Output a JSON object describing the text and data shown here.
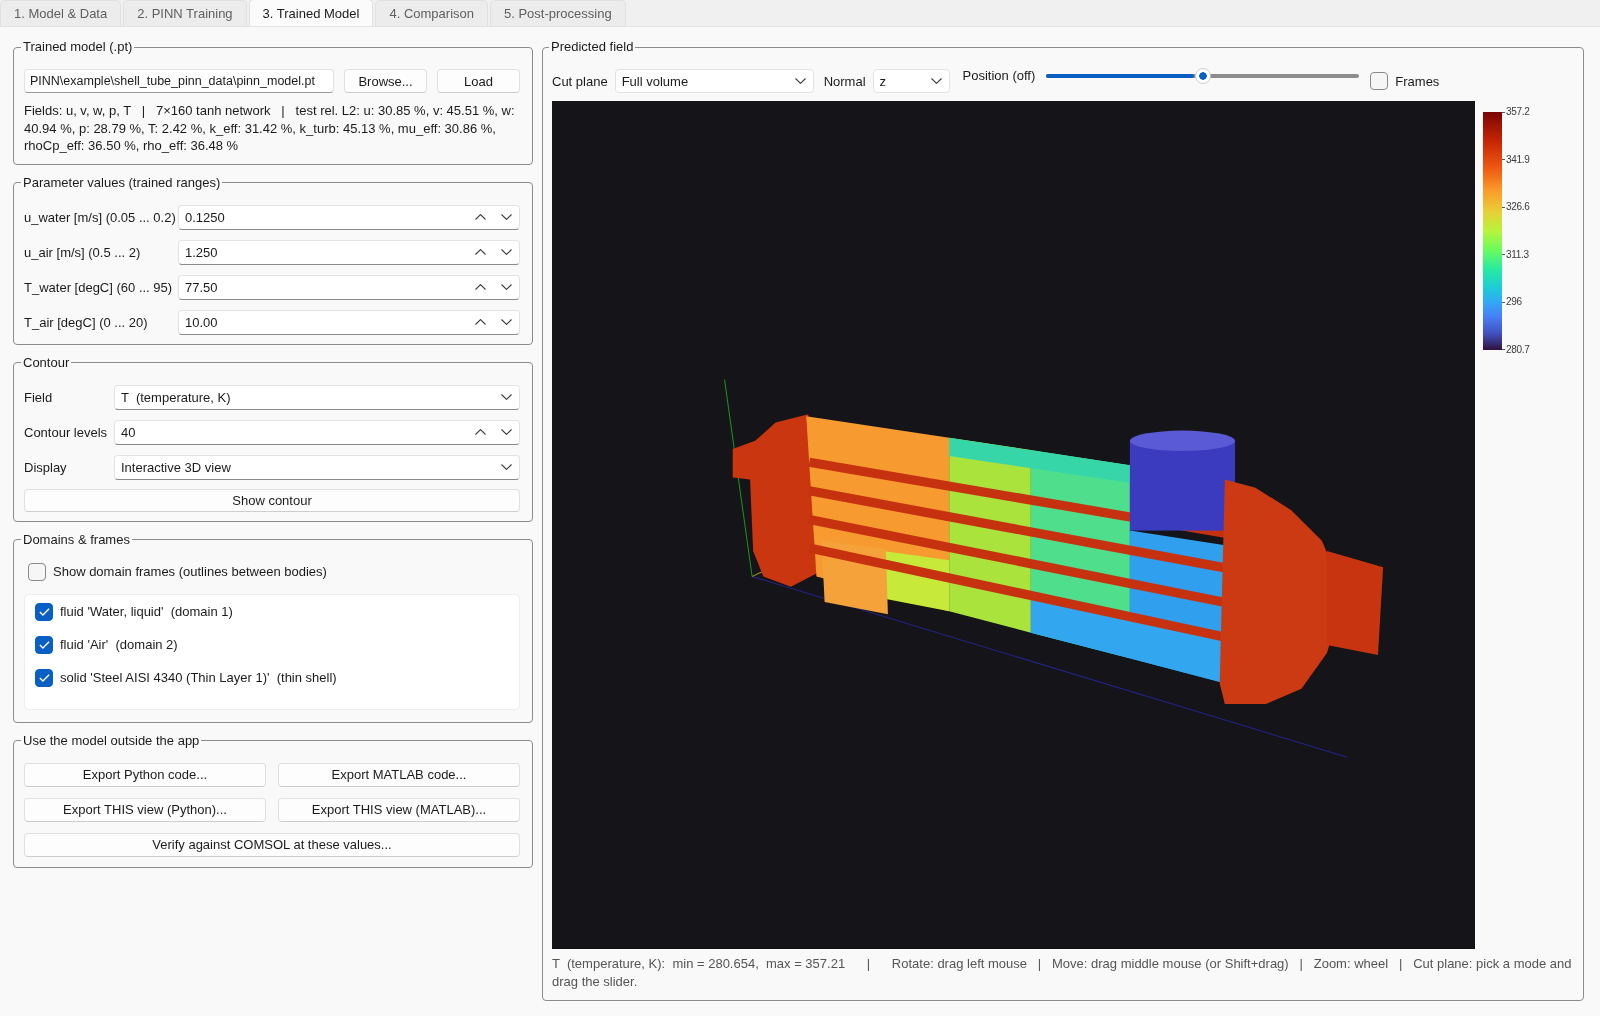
{
  "tabs": [
    {
      "label": "1. Model & Data",
      "selected": false
    },
    {
      "label": "2. PINN Training",
      "selected": false
    },
    {
      "label": "3. Trained Model",
      "selected": true
    },
    {
      "label": "4. Comparison",
      "selected": false
    },
    {
      "label": "5. Post-processing",
      "selected": false
    }
  ],
  "trained_model": {
    "title": "Trained model (.pt)",
    "path": "PINN\\example\\shell_tube_pinn_data\\pinn_model.pt",
    "buttons": [
      "Browse...",
      "Load"
    ],
    "info": "Fields: u, v, w, p, T   |   7×160 tanh network   |   test rel. L2: u: 30.85 %, v: 45.51 %, w: 40.94 %, p: 28.79 %, T: 2.42 %, k_eff: 31.42 %, k_turb: 45.13 %, mu_eff: 30.86 %, rhoCp_eff: 36.50 %, rho_eff: 36.48 %"
  },
  "parameters": {
    "title": "Parameter values (trained ranges)",
    "rows": [
      {
        "label": "u_water [m/s] (0.05 ... 0.2)",
        "value": "0.1250"
      },
      {
        "label": "u_air [m/s] (0.5 ... 2)",
        "value": "1.250"
      },
      {
        "label": "T_water [degC] (60 ... 95)",
        "value": "77.50"
      },
      {
        "label": "T_air [degC] (0 ... 20)",
        "value": "10.00"
      }
    ]
  },
  "contour": {
    "title": "Contour",
    "rows": [
      {
        "kind": "combo",
        "label": "Field",
        "value": "T  (temperature, K)"
      },
      {
        "kind": "spin",
        "label": "Contour levels",
        "value": "40"
      },
      {
        "kind": "combo",
        "label": "Display",
        "value": "Interactive 3D view"
      }
    ],
    "button": "Show contour"
  },
  "domains": {
    "title": "Domains & frames",
    "show_frames": {
      "label": "Show domain frames (outlines between bodies)",
      "checked": false
    },
    "items": [
      {
        "label": "fluid 'Water, liquid'  (domain 1)",
        "checked": true
      },
      {
        "label": "fluid 'Air'  (domain 2)",
        "checked": true
      },
      {
        "label": "solid 'Steel AISI 4340 (Thin Layer 1)'  (thin shell)",
        "checked": true
      }
    ]
  },
  "export": {
    "title": "Use the model outside the app",
    "rows": [
      [
        "Export Python code...",
        "Export MATLAB code..."
      ],
      [
        "Export THIS view (Python)...",
        "Export THIS view (MATLAB)..."
      ],
      [
        "Verify against COMSOL at these values..."
      ]
    ]
  },
  "predicted_field": {
    "title": "Predicted field",
    "cut_plane": {
      "label": "Cut plane",
      "value": "Full volume"
    },
    "normal": {
      "label": "Normal",
      "value": "z"
    },
    "position": {
      "label": "Position (off)",
      "level": 0.5
    },
    "frames": {
      "label": "Frames",
      "checked": false
    },
    "colorbar": {
      "ticks": [
        "357.2",
        "341.9",
        "326.6",
        "311.3",
        "296",
        "280.7"
      ]
    },
    "status": "T  (temperature, K):  min = 280.654,  max = 357.21      |      Rotate: drag left mouse   |   Move: drag middle mouse (or Shift+drag)   |   Zoom: wheel   |   Cut plane: pick a mode and drag the slider."
  }
}
